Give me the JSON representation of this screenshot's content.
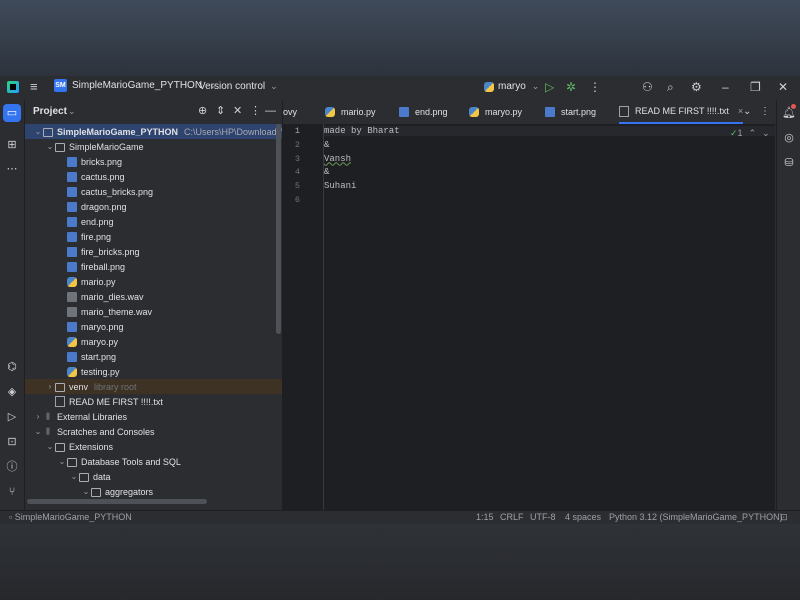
{
  "titlebar": {
    "project_badge": "SM",
    "project_name": "SimpleMarioGame_PYTHON",
    "version_control": "Version control",
    "run_config": "maryo"
  },
  "project_panel": {
    "title": "Project",
    "tree": [
      {
        "label": "SimpleMarioGame_PYTHON",
        "extra": "C:\\Users\\HP\\Downloads\\Si",
        "icon": "folder",
        "level": 0,
        "arrow": "down",
        "selected": true
      },
      {
        "label": "SimpleMarioGame",
        "icon": "folder",
        "level": 1,
        "arrow": "down"
      },
      {
        "label": "bricks.png",
        "icon": "png",
        "level": 2
      },
      {
        "label": "cactus.png",
        "icon": "png",
        "level": 2
      },
      {
        "label": "cactus_bricks.png",
        "icon": "png",
        "level": 2
      },
      {
        "label": "dragon.png",
        "icon": "png",
        "level": 2
      },
      {
        "label": "end.png",
        "icon": "png",
        "level": 2
      },
      {
        "label": "fire.png",
        "icon": "png",
        "level": 2
      },
      {
        "label": "fire_bricks.png",
        "icon": "png",
        "level": 2
      },
      {
        "label": "fireball.png",
        "icon": "png",
        "level": 2
      },
      {
        "label": "mario.py",
        "icon": "py",
        "level": 2
      },
      {
        "label": "mario_dies.wav",
        "icon": "wav",
        "level": 2
      },
      {
        "label": "mario_theme.wav",
        "icon": "wav",
        "level": 2
      },
      {
        "label": "maryo.png",
        "icon": "png",
        "level": 2
      },
      {
        "label": "maryo.py",
        "icon": "py",
        "level": 2
      },
      {
        "label": "start.png",
        "icon": "png",
        "level": 2
      },
      {
        "label": "testing.py",
        "icon": "py",
        "level": 2
      },
      {
        "label": "venv",
        "extra_dim": "library root",
        "icon": "folder",
        "level": 1,
        "arrow": "right",
        "venv": true
      },
      {
        "label": "READ ME FIRST !!!!.txt",
        "icon": "txt",
        "level": 1
      },
      {
        "label": "External Libraries",
        "icon": "lib",
        "level": 0,
        "arrow": "right"
      },
      {
        "label": "Scratches and Consoles",
        "icon": "lib",
        "level": 0,
        "arrow": "down"
      },
      {
        "label": "Extensions",
        "icon": "folder",
        "level": 1,
        "arrow": "down"
      },
      {
        "label": "Database Tools and SQL",
        "icon": "folder",
        "level": 2,
        "arrow": "down"
      },
      {
        "label": "data",
        "icon": "folder",
        "level": 3,
        "arrow": "down"
      },
      {
        "label": "aggregators",
        "icon": "folder",
        "level": 4,
        "arrow": "down"
      }
    ]
  },
  "tabs": [
    {
      "label": "ovy",
      "icon": "none"
    },
    {
      "label": "mario.py",
      "icon": "py"
    },
    {
      "label": "end.png",
      "icon": "png"
    },
    {
      "label": "maryo.py",
      "icon": "py"
    },
    {
      "label": "start.png",
      "icon": "png"
    },
    {
      "label": "READ ME FIRST !!!!.txt",
      "icon": "txt",
      "active": true
    }
  ],
  "editor": {
    "inspection_count": "1",
    "lines": [
      {
        "n": "1",
        "text": "made by Bharat"
      },
      {
        "n": "2",
        "text": "&"
      },
      {
        "n": "3",
        "text": "Vansh",
        "squiggle": true
      },
      {
        "n": "4",
        "text": "&"
      },
      {
        "n": "5",
        "text": "Suhani"
      },
      {
        "n": "6",
        "text": ""
      }
    ]
  },
  "statusbar": {
    "breadcrumb": "SimpleMarioGame_PYTHON",
    "position": "1:15",
    "line_sep": "CRLF",
    "encoding": "UTF-8",
    "indent": "4 spaces",
    "interpreter": "Python 3.12 (SimpleMarioGame_PYTHON)"
  },
  "colors": {
    "accent": "#3574f0",
    "selection": "#2e436e",
    "run_green": "#5fb865"
  }
}
